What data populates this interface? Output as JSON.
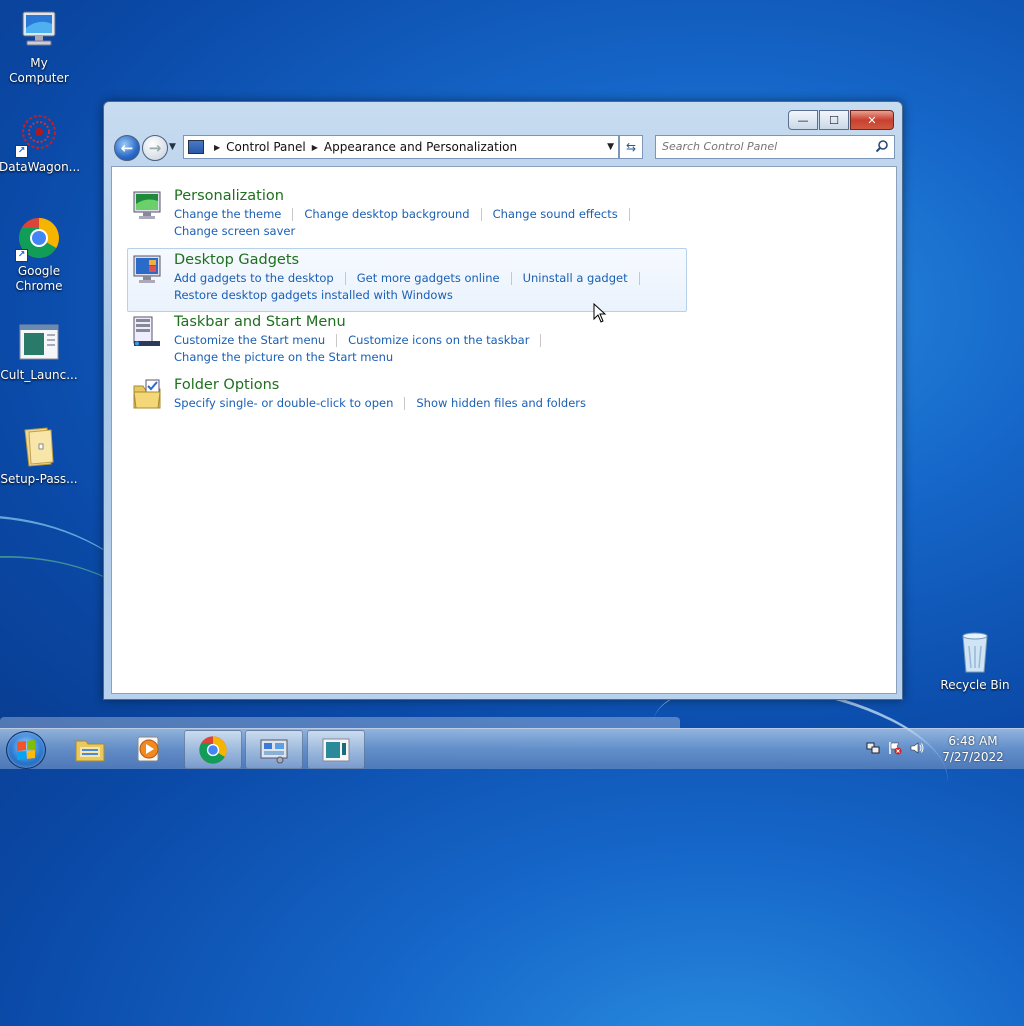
{
  "desktop": {
    "icons": [
      {
        "label": "My Computer"
      },
      {
        "label": "DataWagon..."
      },
      {
        "label": "Google Chrome"
      },
      {
        "label": "Cult_Launc..."
      },
      {
        "label": "Setup-Pass..."
      },
      {
        "label": "Recycle Bin"
      }
    ]
  },
  "window": {
    "breadcrumb": [
      "Control Panel",
      "Appearance and Personalization"
    ],
    "search_placeholder": "Search Control Panel",
    "caption_buttons": {
      "minimize": "—",
      "maximize": "☐",
      "close": "✕"
    }
  },
  "categories": [
    {
      "title": "Personalization",
      "icon": "personalization-icon",
      "links_row1": [
        "Change the theme",
        "Change desktop background",
        "Change sound effects"
      ],
      "links_row2": [
        "Change screen saver"
      ]
    },
    {
      "title": "Desktop Gadgets",
      "icon": "desktop-gadgets-icon",
      "links_row1": [
        "Add gadgets to the desktop",
        "Get more gadgets online",
        "Uninstall a gadget"
      ],
      "links_row2": [
        "Restore desktop gadgets installed with Windows"
      ]
    },
    {
      "title": "Taskbar and Start Menu",
      "icon": "taskbar-icon",
      "links_row1": [
        "Customize the Start menu",
        "Customize icons on the taskbar"
      ],
      "links_row2": [
        "Change the picture on the Start menu"
      ]
    },
    {
      "title": "Folder Options",
      "icon": "folder-options-icon",
      "links_row1": [
        "Specify single- or double-click to open",
        "Show hidden files and folders"
      ],
      "links_row2": []
    }
  ],
  "taskbar": {
    "pinned": [
      "windows-explorer-icon",
      "media-player-icon",
      "chrome-icon",
      "control-panel-icon",
      "cult-launcher-icon"
    ],
    "clock_time": "6:48 AM",
    "clock_date": "7/27/2022"
  },
  "colors": {
    "category_title": "#1e6f1e",
    "link": "#1a5fb4",
    "desktop_bg": "#1566c8"
  }
}
